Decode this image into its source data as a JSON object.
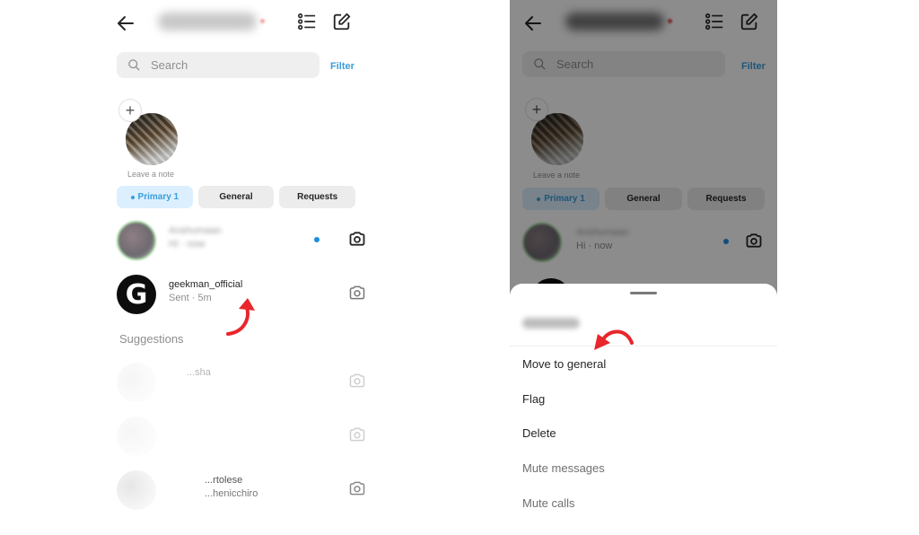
{
  "left": {
    "header": {
      "back_icon": "arrow-left-icon",
      "username": "(blurred)",
      "list_icon": "list-icon",
      "compose_icon": "compose-icon"
    },
    "search": {
      "placeholder": "Search",
      "filter_label": "Filter"
    },
    "note": {
      "label": "Leave a note",
      "add_icon": "plus-icon"
    },
    "tabs": [
      {
        "label": "Primary 1",
        "active": true
      },
      {
        "label": "General",
        "active": false
      },
      {
        "label": "Requests",
        "active": false
      }
    ],
    "threads": [
      {
        "name": "Anshumaan",
        "subtitle": "Hi · now",
        "unread": true,
        "blurred": true
      },
      {
        "name": "geekman_official",
        "subtitle": "Sent · 5m",
        "unread": false,
        "blurred": false
      }
    ],
    "suggestions_title": "Suggestions",
    "suggestions": [
      {
        "name": "...sha",
        "subtitle": ""
      },
      {
        "name": "",
        "subtitle": ""
      },
      {
        "name": "...rtolese",
        "subtitle": "...henicchiro"
      }
    ]
  },
  "right": {
    "header": {
      "username": "(blurred)"
    },
    "search": {
      "placeholder": "Search",
      "filter_label": "Filter"
    },
    "note": {
      "label": "Leave a note"
    },
    "tabs": [
      {
        "label": "Primary 1",
        "active": true
      },
      {
        "label": "General",
        "active": false
      },
      {
        "label": "Requests",
        "active": false
      }
    ],
    "thread": {
      "name": "Anshumaan",
      "subtitle": "Hi · now"
    },
    "sheet": {
      "title": "Anshumaan",
      "items": [
        "Move to general",
        "Flag",
        "Delete",
        "Mute messages",
        "Mute calls"
      ]
    }
  },
  "annotation_color": "#e8262b"
}
